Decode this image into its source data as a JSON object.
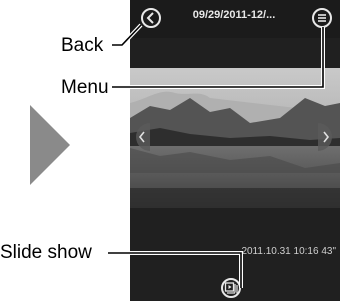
{
  "topbar": {
    "title": "09/29/2011-12/..."
  },
  "photo": {
    "info": "2011.10.31 10:16 43\""
  },
  "callouts": {
    "back": "Back",
    "menu": "Menu",
    "slideshow": "Slide show"
  },
  "icons": {
    "back": "chevron-left-icon",
    "menu": "hamburger-icon",
    "prev": "chevron-left-icon",
    "next": "chevron-right-icon",
    "slideshow": "slideshow-icon",
    "pointer": "triangle-right-icon"
  }
}
